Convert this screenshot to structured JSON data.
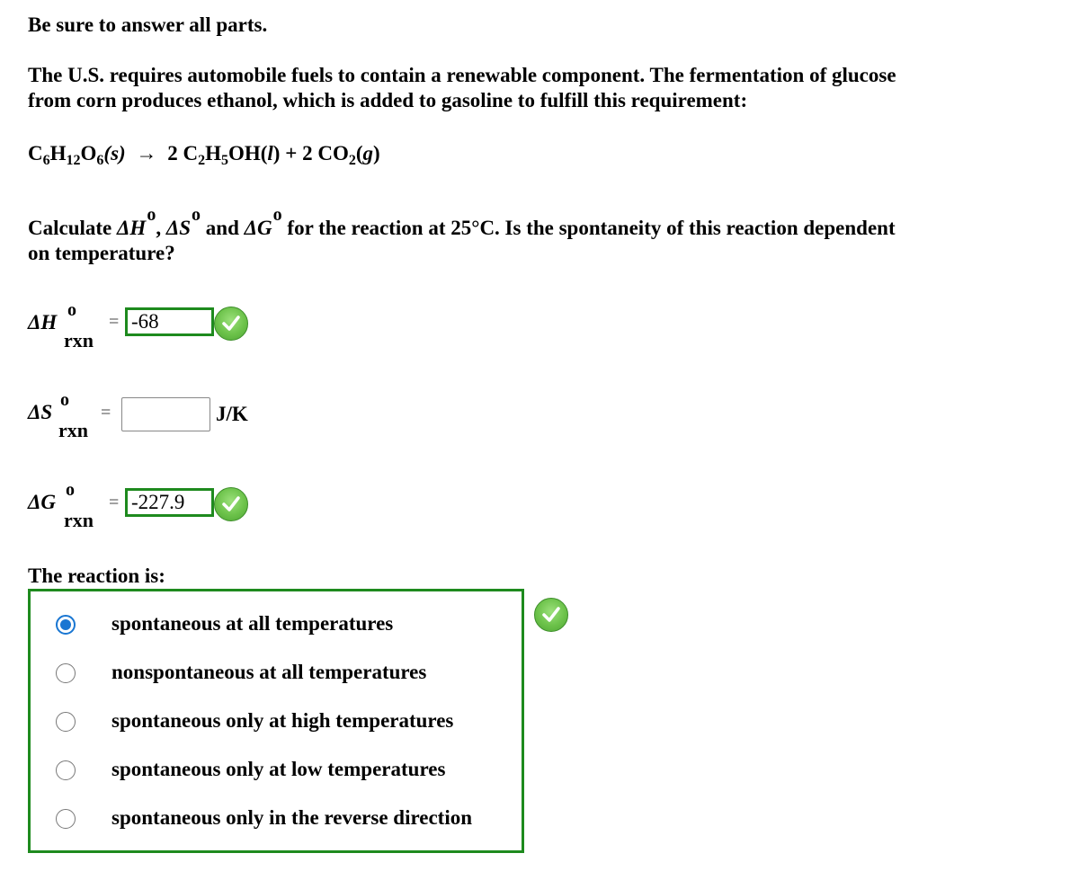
{
  "instruction": "Be sure to answer all parts.",
  "problem": {
    "line1": "The U.S. requires automobile fuels to contain a renewable component. The fermentation of glucose",
    "line2": "from corn produces ethanol, which is added to gasoline to fulfill this requirement:"
  },
  "equation": {
    "reactant": {
      "C": "C",
      "c_sub": "6",
      "H": "H",
      "h_sub": "12",
      "O": "O",
      "o_sub": "6",
      "state": "(s)"
    },
    "arrow": "→",
    "product1": {
      "coef": "2",
      "formula_a": "C",
      "sub_a": "2",
      "formula_b": "H",
      "sub_b": "5",
      "formula_c": "OH(",
      "state": "l",
      "close": ")"
    },
    "plus": "+",
    "product2": {
      "coef": "2",
      "formula": "CO",
      "sub": "2",
      "state": "g"
    }
  },
  "question": {
    "calc": "Calculate ",
    "dH": "ΔH",
    "comma": ", ",
    "dS": "ΔS",
    "and": " and ",
    "dG": "ΔG",
    "rest": " for the reaction at 25°C. Is the spontaneity of this reaction dependent",
    "line2": "on temperature?",
    "degree": "o"
  },
  "answers": {
    "dH": {
      "label": "ΔH",
      "sup": "o",
      "sub": "rxn",
      "eq": "=",
      "value": "-68",
      "status": "correct"
    },
    "dS": {
      "label": "ΔS",
      "sup": "o",
      "sub": "rxn",
      "eq": "=",
      "value": "",
      "unit": "J/K",
      "status": "unanswered"
    },
    "dG": {
      "label": "ΔG",
      "sup": "o",
      "sub": "rxn",
      "eq": "=",
      "value": "-227.9",
      "status": "correct"
    }
  },
  "reaction_question": "The reaction is:",
  "choices": [
    {
      "label": "spontaneous at all temperatures",
      "selected": true
    },
    {
      "label": "nonspontaneous at all temperatures",
      "selected": false
    },
    {
      "label": "spontaneous only at high temperatures",
      "selected": false
    },
    {
      "label": "spontaneous only at low temperatures",
      "selected": false
    },
    {
      "label": "spontaneous only in the reverse direction",
      "selected": false
    }
  ],
  "colors": {
    "correct_border": "#1e8a1e",
    "check_green": "#6cc24a",
    "radio_selected": "#1976d2"
  }
}
